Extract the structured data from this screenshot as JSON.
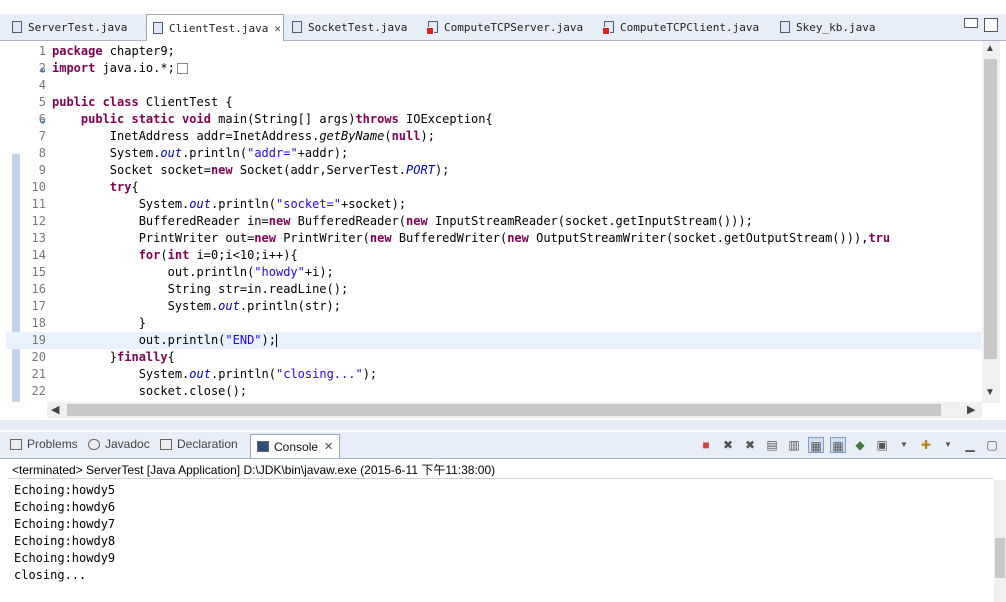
{
  "editor_tabs": [
    {
      "label": "ServerTest.java",
      "active": false,
      "error": false
    },
    {
      "label": "ClientTest.java",
      "active": true,
      "error": false
    },
    {
      "label": "SocketTest.java",
      "active": false,
      "error": false
    },
    {
      "label": "ComputeTCPServer.java",
      "active": false,
      "error": true
    },
    {
      "label": "ComputeTCPClient.java",
      "active": false,
      "error": true
    },
    {
      "label": "Skey_kb.java",
      "active": false,
      "error": false
    }
  ],
  "code_lines": [
    {
      "n": "1",
      "html": "<span class='kw'>package</span> chapter9;"
    },
    {
      "n": "2",
      "html": "<span class='kw'>import</span> java.io.*;<span class='collapsed-box'></span>",
      "fold": "⊕"
    },
    {
      "n": "4",
      "html": ""
    },
    {
      "n": "5",
      "html": "<span class='kw'>public class</span> ClientTest {"
    },
    {
      "n": "6",
      "html": "    <span class='kw'>public static void</span> main(String[] args)<span class='kw'>throws</span> IOException{",
      "fold": "⊖"
    },
    {
      "n": "7",
      "html": "        InetAddress addr=InetAddress.<span class='it'>getByName</span>(<span class='kw'>null</span>);"
    },
    {
      "n": "8",
      "html": "        System.<span class='fld'>out</span>.println(<span class='str'>\"addr=\"</span>+addr);"
    },
    {
      "n": "9",
      "html": "        Socket socket=<span class='kw'>new</span> Socket(addr,ServerTest.<span class='fld'>PORT</span>);"
    },
    {
      "n": "10",
      "html": "        <span class='kw'>try</span>{"
    },
    {
      "n": "11",
      "html": "            System.<span class='fld'>out</span>.println(<span class='str'>\"socket=\"</span>+socket);"
    },
    {
      "n": "12",
      "html": "            BufferedReader in=<span class='kw'>new</span> BufferedReader(<span class='kw'>new</span> InputStreamReader(socket.getInputStream()));"
    },
    {
      "n": "13",
      "html": "            PrintWriter out=<span class='kw'>new</span> PrintWriter(<span class='kw'>new</span> BufferedWriter(<span class='kw'>new</span> OutputStreamWriter(socket.getOutputStream())),<span class='kw'>tru</span>"
    },
    {
      "n": "14",
      "html": "            <span class='kw'>for</span>(<span class='kw'>int</span> i=0;i<10;i++){"
    },
    {
      "n": "15",
      "html": "                out.println(<span class='str'>\"howdy\"</span>+i);"
    },
    {
      "n": "16",
      "html": "                String str=in.readLine();"
    },
    {
      "n": "17",
      "html": "                System.<span class='fld'>out</span>.println(str);"
    },
    {
      "n": "18",
      "html": "            }"
    },
    {
      "n": "19",
      "html": "            out.println(<span class='str'>\"END\"</span>);<span class='cursor'></span>",
      "current": true
    },
    {
      "n": "20",
      "html": "        }<span class='kw'>finally</span>{"
    },
    {
      "n": "21",
      "html": "            System.<span class='fld'>out</span>.println(<span class='str'>\"closing...\"</span>);"
    },
    {
      "n": "22",
      "html": "            socket.close();"
    }
  ],
  "console_tabs": [
    {
      "label": "Problems",
      "active": false,
      "icon": "problems-icon"
    },
    {
      "label": "Javadoc",
      "active": false,
      "icon": "javadoc-icon"
    },
    {
      "label": "Declaration",
      "active": false,
      "icon": "declaration-icon"
    },
    {
      "label": "Console",
      "active": true,
      "icon": "console-icon"
    }
  ],
  "console": {
    "header": "<terminated> ServerTest [Java Application] D:\\JDK\\bin\\javaw.exe (2015-6-11 下午11:38:00)",
    "lines": [
      "Echoing:howdy5",
      "Echoing:howdy6",
      "Echoing:howdy7",
      "Echoing:howdy8",
      "Echoing:howdy9",
      "closing..."
    ]
  },
  "icons": {
    "tab_close": "✕",
    "scroll_up": "▲",
    "scroll_down": "▼",
    "scroll_left": "◀",
    "scroll_right": "▶"
  }
}
